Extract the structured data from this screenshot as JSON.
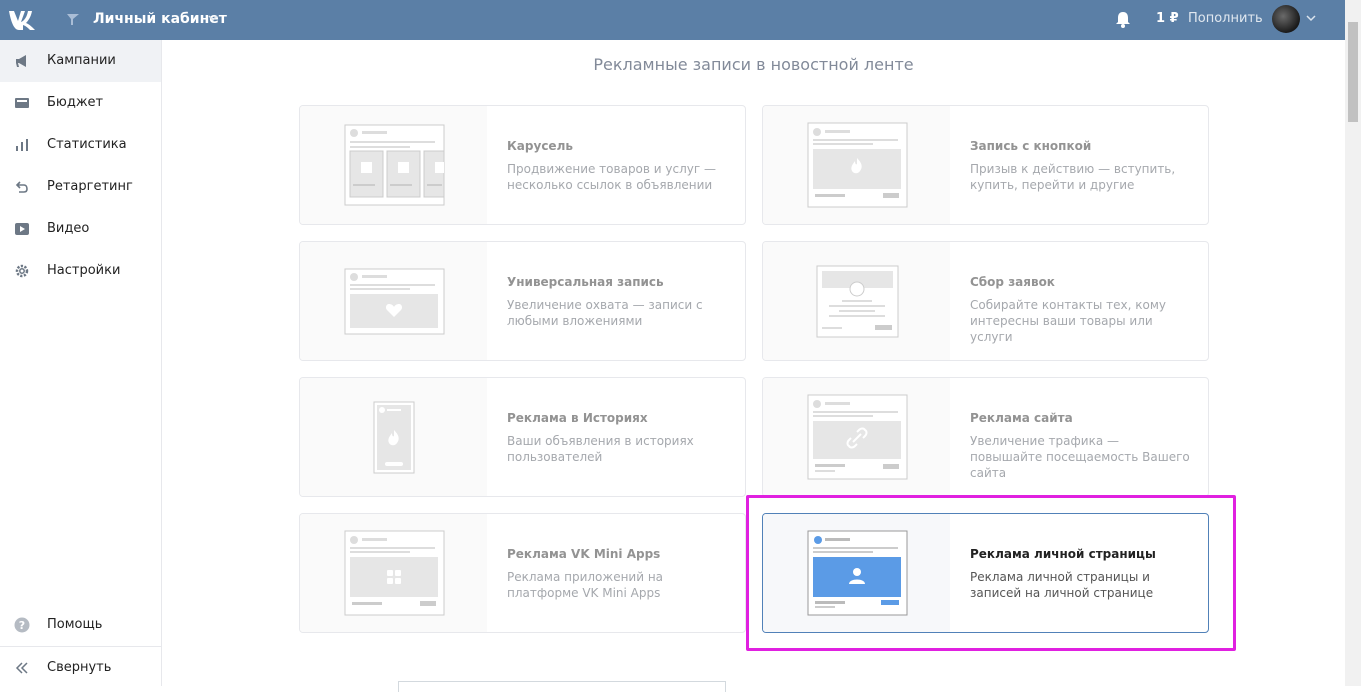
{
  "header": {
    "logo": "vk-logo",
    "cabinet_label": "Личный кабинет",
    "balance": "1 ₽",
    "topup_label": "Пополнить"
  },
  "sidebar": {
    "items": [
      {
        "label": "Кампании",
        "icon": "megaphone-icon",
        "active": true
      },
      {
        "label": "Бюджет",
        "icon": "wallet-icon"
      },
      {
        "label": "Статистика",
        "icon": "bar-chart-icon"
      },
      {
        "label": "Ретаргетинг",
        "icon": "retarget-icon"
      },
      {
        "label": "Видео",
        "icon": "video-icon"
      },
      {
        "label": "Настройки",
        "icon": "gear-icon"
      }
    ],
    "help_label": "Помощь",
    "collapse_label": "Свернуть"
  },
  "main": {
    "title": "Рекламные записи в новостной ленте",
    "cards": [
      {
        "title": "Карусель",
        "desc": "Продвижение товаров и услуг — несколько ссылок в объявлении"
      },
      {
        "title": "Запись с кнопкой",
        "desc": "Призыв к действию — вступить, купить, перейти и другие"
      },
      {
        "title": "Универсальная запись",
        "desc": "Увеличение охвата — записи с любыми вложениями"
      },
      {
        "title": "Сбор заявок",
        "desc": "Собирайте контакты тех, кому интересны ваши товары или услуги"
      },
      {
        "title": "Реклама в Историях",
        "desc": "Ваши объявления в историях пользователей"
      },
      {
        "title": "Реклама сайта",
        "desc": "Увеличение трафика — повышайте посещаемость Вашего сайта"
      },
      {
        "title": "Реклама VK Mini Apps",
        "desc": "Реклама приложений на платформе VK Mini Apps"
      },
      {
        "title": "Реклама личной страницы",
        "desc": "Реклама личной страницы и записей на личной странице",
        "selected": true
      }
    ]
  },
  "colors": {
    "header": "#5b7fa6",
    "selected_border": "#5181b8",
    "highlight": "#e020e0",
    "accent": "#5b9be6"
  }
}
